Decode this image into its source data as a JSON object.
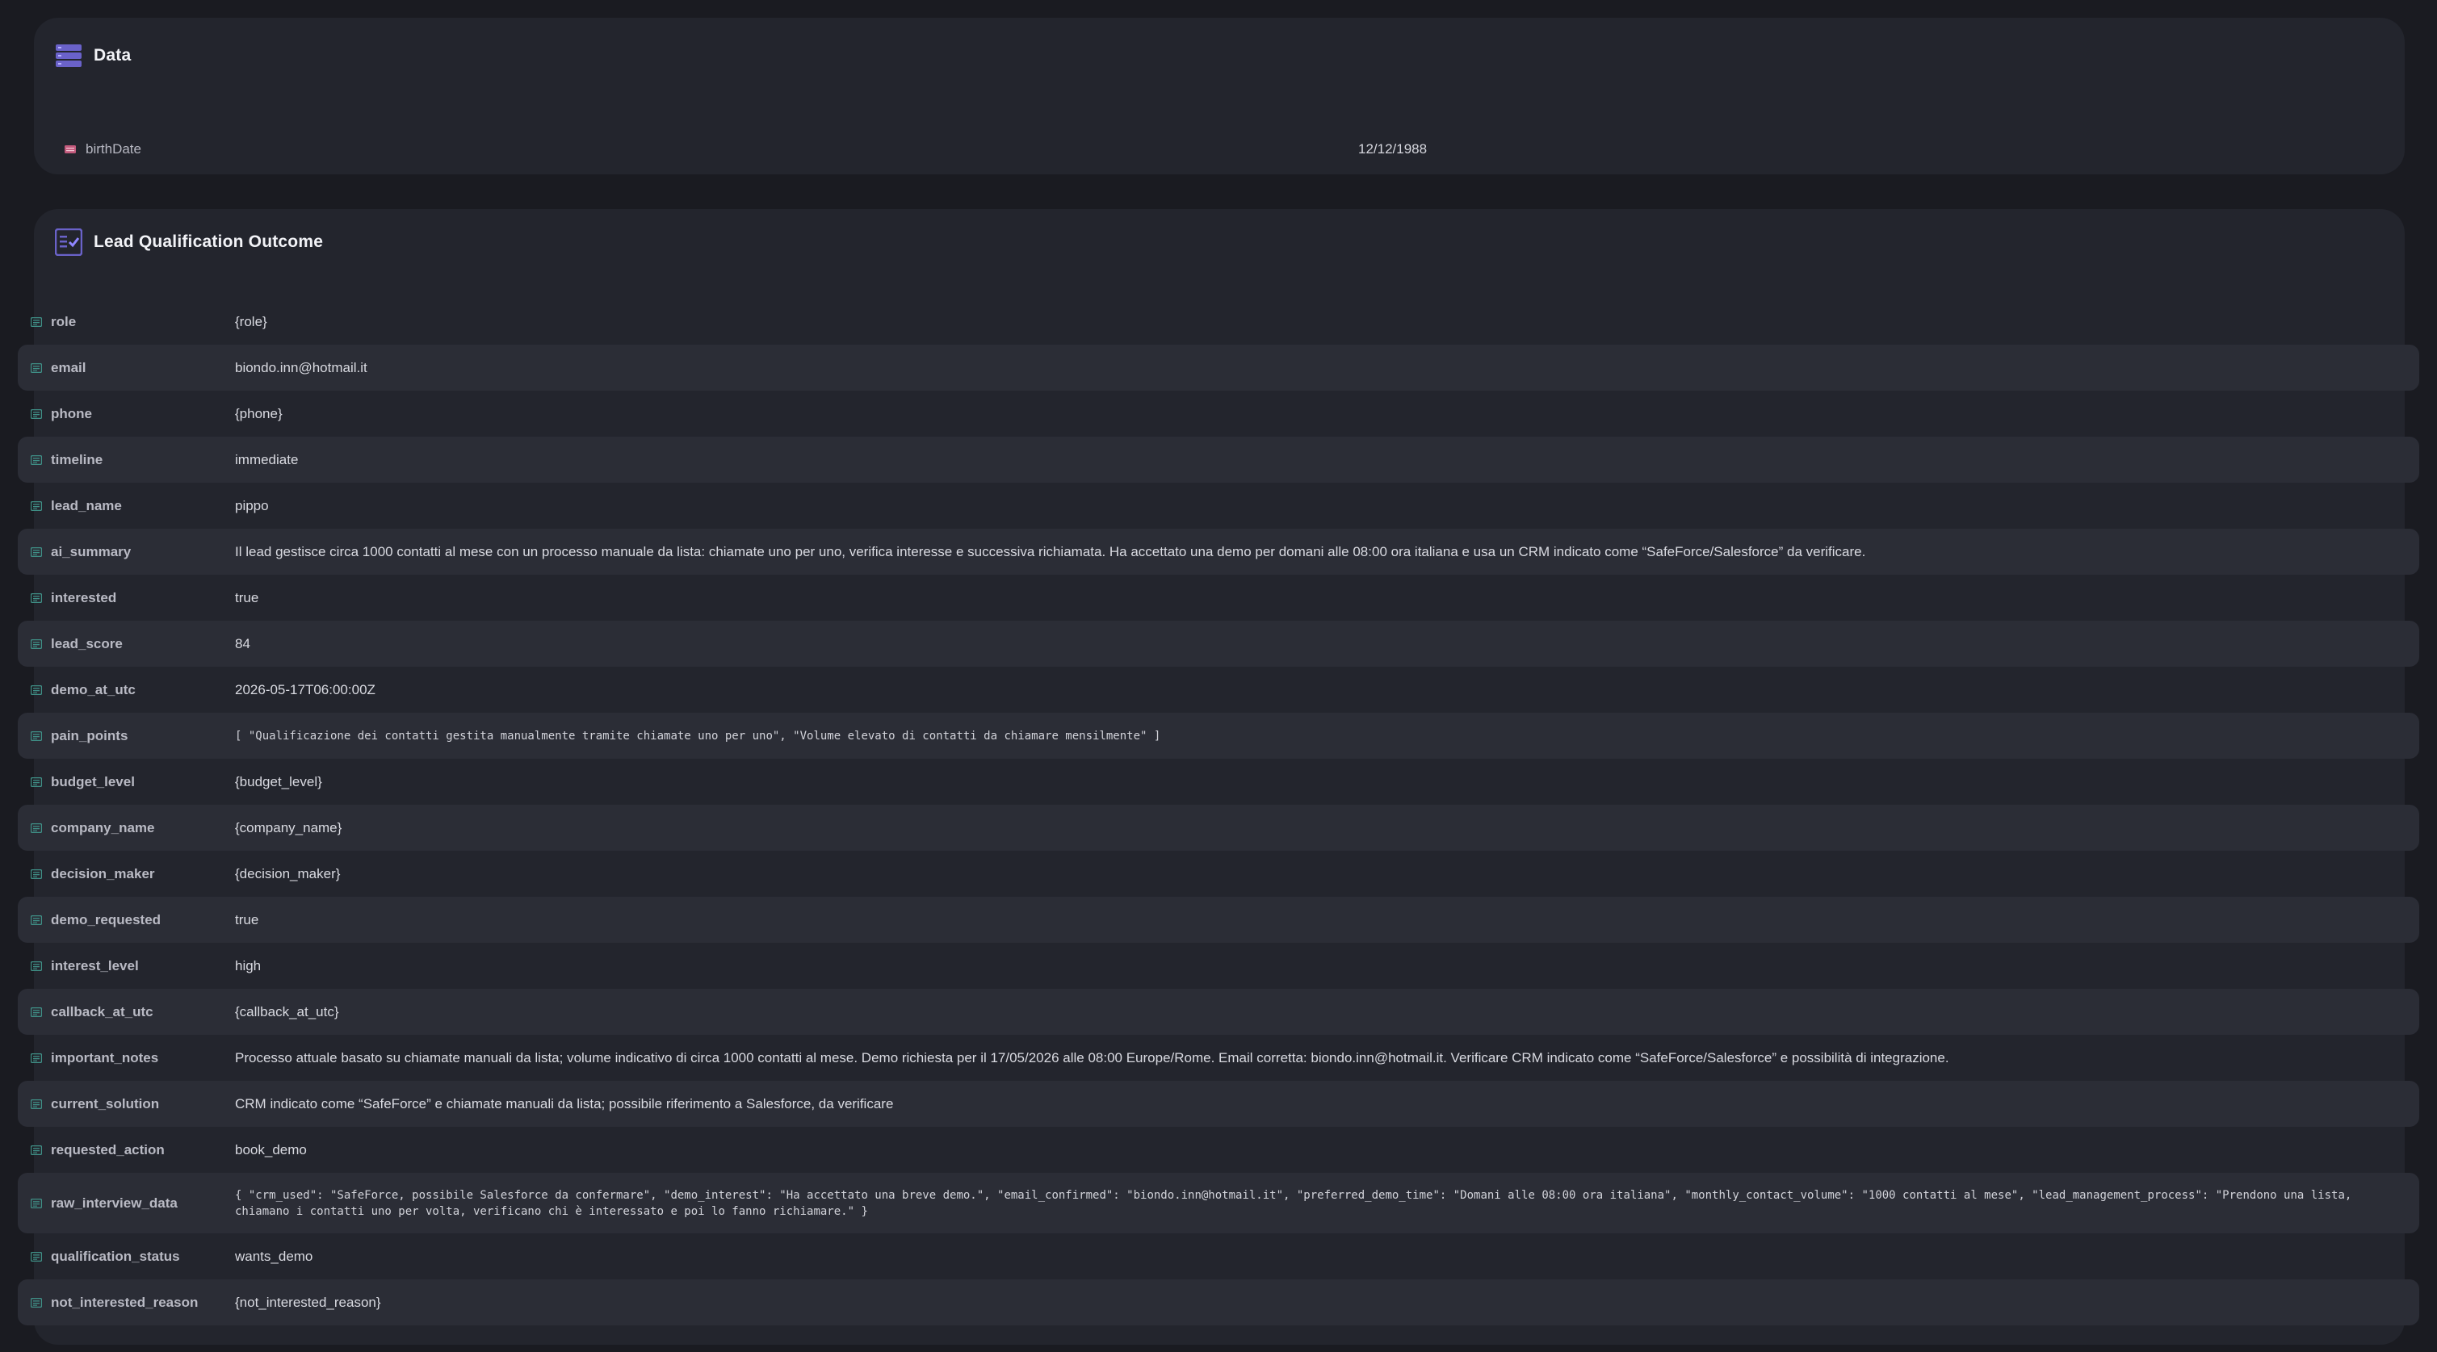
{
  "data_panel": {
    "title": "Data",
    "birth_label": "birthDate",
    "birth_value": "12/12/1988"
  },
  "lead_panel": {
    "title": "Lead Qualification Outcome",
    "rows": [
      {
        "key": "role",
        "value": "{role}"
      },
      {
        "key": "email",
        "value": "biondo.inn@hotmail.it"
      },
      {
        "key": "phone",
        "value": "{phone}"
      },
      {
        "key": "timeline",
        "value": "immediate"
      },
      {
        "key": "lead_name",
        "value": "pippo"
      },
      {
        "key": "ai_summary",
        "value": "Il lead gestisce circa 1000 contatti al mese con un processo manuale da lista: chiamate uno per uno, verifica interesse e successiva richiamata. Ha accettato una demo per domani alle 08:00 ora italiana e usa un CRM indicato come “SafeForce/Salesforce” da verificare."
      },
      {
        "key": "interested",
        "value": "true"
      },
      {
        "key": "lead_score",
        "value": "84"
      },
      {
        "key": "demo_at_utc",
        "value": "2026-05-17T06:00:00Z"
      },
      {
        "key": "pain_points",
        "value": "[ \"Qualificazione dei contatti gestita manualmente tramite chiamate uno per uno\", \"Volume elevato di contatti da chiamare mensilmente\" ]"
      },
      {
        "key": "budget_level",
        "value": "{budget_level}"
      },
      {
        "key": "company_name",
        "value": "{company_name}"
      },
      {
        "key": "decision_maker",
        "value": "{decision_maker}"
      },
      {
        "key": "demo_requested",
        "value": "true"
      },
      {
        "key": "interest_level",
        "value": "high"
      },
      {
        "key": "callback_at_utc",
        "value": "{callback_at_utc}"
      },
      {
        "key": "important_notes",
        "value": "Processo attuale basato su chiamate manuali da lista; volume indicativo di circa 1000 contatti al mese. Demo richiesta per il 17/05/2026 alle 08:00 Europe/Rome. Email corretta: biondo.inn@hotmail.it. Verificare CRM indicato come “SafeForce/Salesforce” e possibilità di integrazione."
      },
      {
        "key": "current_solution",
        "value": "CRM indicato come “SafeForce” e chiamate manuali da lista; possibile riferimento a Salesforce, da verificare"
      },
      {
        "key": "requested_action",
        "value": "book_demo"
      },
      {
        "key": "raw_interview_data",
        "value": "{ \"crm_used\": \"SafeForce, possibile Salesforce da confermare\", \"demo_interest\": \"Ha accettato una breve demo.\", \"email_confirmed\": \"biondo.inn@hotmail.it\", \"preferred_demo_time\": \"Domani alle 08:00 ora italiana\", \"monthly_contact_volume\": \"1000 contatti al mese\", \"lead_management_process\": \"Prendono una lista, chiamano i contatti uno per volta, verificano chi è interessato e poi lo fanno richiamare.\" }"
      },
      {
        "key": "qualification_status",
        "value": "wants_demo"
      },
      {
        "key": "not_interested_reason",
        "value": "{not_interested_reason}"
      }
    ]
  },
  "colors": {
    "page_bg": "#1a1b21",
    "panel_bg": "#23252d",
    "row_alt_bg": "#2b2d36",
    "accent_icon": "#6a62c9",
    "row_icon": "#3f8f86",
    "calendar_icon": "#c25a7c"
  },
  "icons": {
    "data_header": "database-icon",
    "lead_header": "checklist-icon",
    "birth": "calendar-icon",
    "row": "table-field-icon"
  }
}
